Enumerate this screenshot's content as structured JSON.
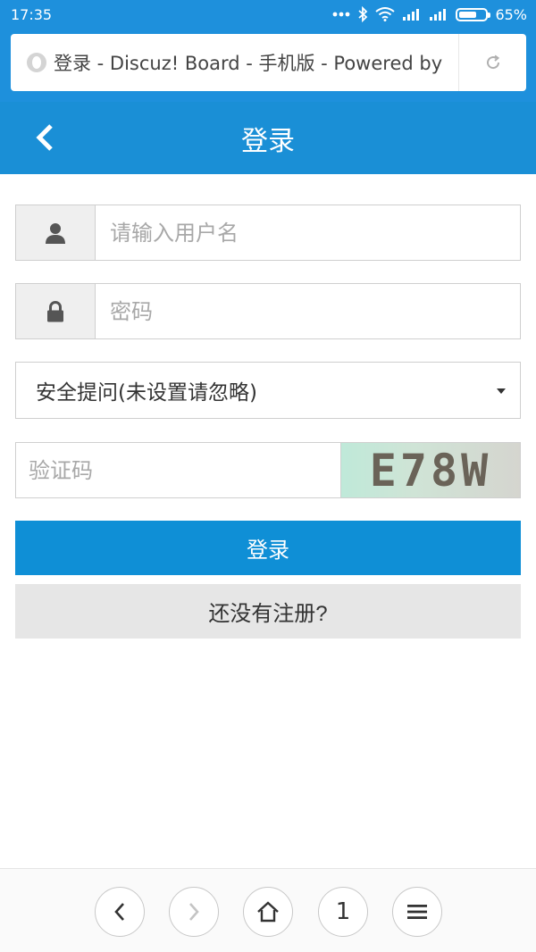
{
  "status_bar": {
    "time": "17:35",
    "battery_label": "65%",
    "battery_level": 0.65
  },
  "browser": {
    "page_title": "登录 - Discuz! Board - 手机版 - Powered by"
  },
  "header": {
    "title": "登录"
  },
  "form": {
    "username_placeholder": "请输入用户名",
    "password_placeholder": "密码",
    "security_question_selected": "安全提问(未设置请忽略)",
    "captcha_placeholder": "验证码",
    "captcha_text": "E78W",
    "login_label": "登录",
    "register_label": "还没有注册?"
  },
  "bottom_nav": {
    "tab_count": "1"
  },
  "colors": {
    "accent": "#1a8fd6",
    "primary_button": "#0f8fd6",
    "secondary_button": "#e6e6e6"
  }
}
